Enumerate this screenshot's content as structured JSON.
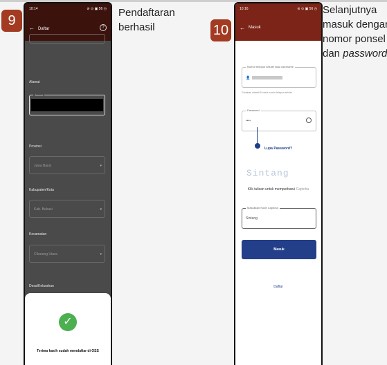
{
  "step9": {
    "number": "9",
    "caption_lines": [
      "Pendaftaran",
      "berhasil"
    ],
    "status_time": "10:14",
    "status_icons": "⊘ ⊙ ▣ 56 ◷",
    "appbar_title": "Daftar",
    "help_icon": "?",
    "labels": {
      "alamat": "Alamat",
      "provinsi": "Provinsi",
      "kabupaten": "Kabupaten/Kota",
      "kecamatan": "Kecamatan",
      "desa": "Desa/Kelurahan"
    },
    "alamat_legend": "Alamat",
    "provinsi_value": "Jawa Barat",
    "kabupaten_value": "Kab. Bekasi",
    "kecamatan_value": "Cikarang Utara",
    "dropdown_arrow": "▾",
    "success_message": "Terima kasih sudah mendaftar di OSS",
    "check_icon": "✓"
  },
  "step10": {
    "number": "10",
    "caption_lines": [
      "Selanjutnya",
      "masuk dengan",
      "nomor ponsel",
      "dan"
    ],
    "caption_italic": "password",
    "status_time": "10:16",
    "status_icons": "⊘ ⊙ ▣ 56 ◷",
    "appbar_title": "Masuk",
    "phone_legend": "Nomor telepon seluler atau username",
    "phone_hint": "Gunakan diawali 8 untuk nomor telepon seluler",
    "password_legend": "Password",
    "password_value": "••••",
    "forgot_password": "Lupa Password?",
    "captcha_text": "Sintang",
    "refresh_text": "Klik tulisan untuk memperbarui",
    "refresh_link": "Captcha",
    "captcha_legend": "Masukkan Kode Captcha",
    "captcha_input": "Sintang",
    "submit_label": "Masuk",
    "register_link": "Daftar"
  },
  "colors": {
    "badge": "#a33a22",
    "appbar": "#7b2417",
    "button": "#233f8a",
    "success": "#4caf50"
  }
}
